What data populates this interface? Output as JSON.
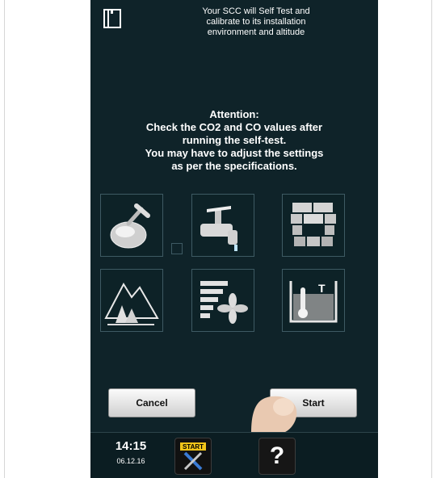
{
  "header": {
    "lines": [
      "Your SCC will Self Test and",
      "calibrate to its installation",
      "environment and altitude"
    ]
  },
  "attention": {
    "lines": [
      "Attention:",
      "Check the CO2 and CO values after",
      "running the self-test.",
      "You may have to adjust the settings",
      "as per the specifications."
    ]
  },
  "tiles": [
    {
      "icon": "gas-valve-icon"
    },
    {
      "icon": "water-tap-icon"
    },
    {
      "icon": "brick-wall-icon"
    },
    {
      "icon": "mountain-trees-icon"
    },
    {
      "icon": "fan-ventilation-icon"
    },
    {
      "icon": "water-temperature-icon"
    }
  ],
  "buttons": {
    "cancel": "Cancel",
    "start": "Start"
  },
  "status": {
    "time": "14:15",
    "date": "06.12.16"
  },
  "bottom": {
    "start_icon_label": "START",
    "help_label": "?"
  },
  "colors": {
    "screen_bg": "#0f2329",
    "tile_border": "#3e5a63"
  }
}
